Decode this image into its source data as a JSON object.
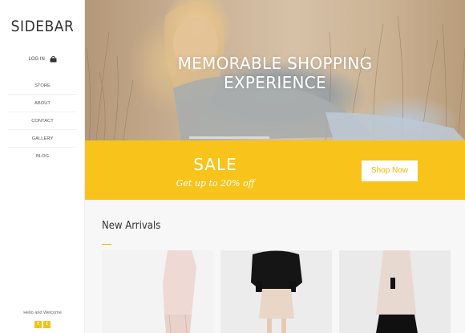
{
  "sidebar": {
    "brand": "SIDEBAR",
    "login_label": "LOG IN",
    "nav": [
      "STORE",
      "ABOUT",
      "CONTACT",
      "GALLERY",
      "BLOG"
    ],
    "welcome": "Hello and Welcome",
    "social": [
      "f",
      "t"
    ]
  },
  "hero": {
    "headline_line1": "MEMORABLE SHOPPING",
    "headline_line2": "EXPERIENCE"
  },
  "sale": {
    "title": "SALE",
    "subtitle": "Get up to 20% off",
    "button_label": "Shop Now"
  },
  "arrivals": {
    "heading": "New Arrivals"
  },
  "colors": {
    "accent": "#f8c41b",
    "button_text": "#f0b400"
  },
  "icons": [
    "shopping-bag-icon",
    "facebook-icon",
    "twitter-icon"
  ]
}
